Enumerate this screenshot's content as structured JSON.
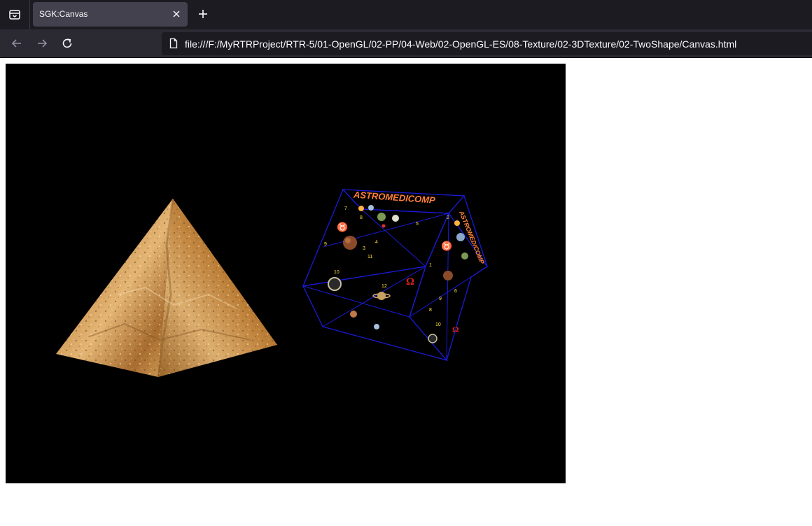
{
  "browser": {
    "tab": {
      "title": "SGK:Canvas"
    },
    "toolbar": {
      "url": "file:///F:/MyRTRProject/RTR-5/01-OpenGL/02-PP/04-Web/02-OpenGL-ES/08-Texture/02-3DTexture/02-TwoShape/Canvas.html"
    },
    "icons": {
      "tab_list": "tab-list-icon",
      "tab_close": "close-icon",
      "new_tab": "plus-icon",
      "back": "back-arrow-icon",
      "forward": "forward-arrow-icon",
      "reload": "reload-icon",
      "page": "page-icon"
    }
  },
  "canvas": {
    "background": "#000000",
    "pyramid": {
      "texture": "stone",
      "colors": [
        "#d9a45c",
        "#b7772f",
        "#f0d49a",
        "#6b4a24"
      ]
    },
    "cube": {
      "texture": "astromedicomp",
      "logo_text": "ASTROMEDICOMP",
      "side_logo_text": "ASTROMEDICOMP",
      "edge_color": "#1a1ad8",
      "logo_color": "#ff7f3a"
    }
  }
}
